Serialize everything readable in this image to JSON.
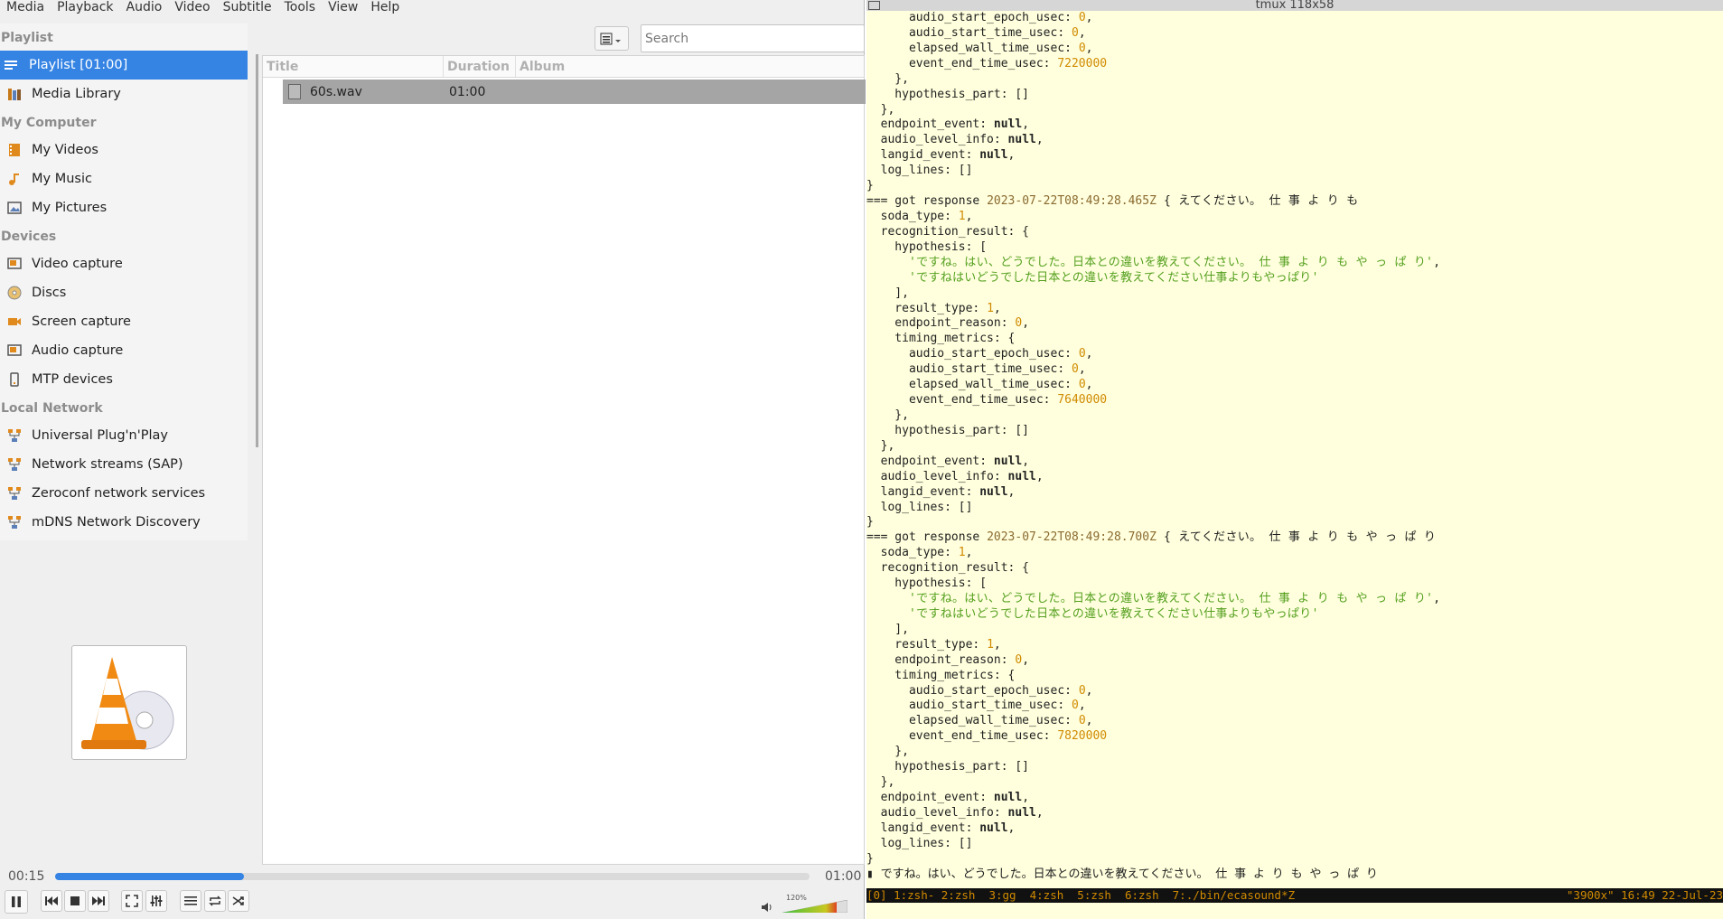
{
  "menubar": [
    "Media",
    "Playback",
    "Audio",
    "Video",
    "Subtitle",
    "Tools",
    "View",
    "Help"
  ],
  "sidebar": {
    "heading_playlist": "Playlist",
    "playlist_item": "Playlist [01:00]",
    "media_library": "Media Library",
    "heading_my_computer": "My Computer",
    "my_computer": [
      "My Videos",
      "My Music",
      "My Pictures"
    ],
    "heading_devices": "Devices",
    "devices": [
      "Video capture",
      "Discs",
      "Screen capture",
      "Audio capture",
      "MTP devices"
    ],
    "heading_local_network": "Local Network",
    "local_network": [
      "Universal Plug'n'Play",
      "Network streams (SAP)",
      "Zeroconf network services",
      "mDNS Network Discovery"
    ]
  },
  "search": {
    "placeholder": "Search"
  },
  "playlist": {
    "columns": [
      "Title",
      "Duration",
      "Album"
    ],
    "rows": [
      {
        "title": "60s.wav",
        "duration": "01:00",
        "album": ""
      }
    ]
  },
  "player": {
    "time_current": "00:15",
    "time_total": "01:00",
    "progress": 0.25,
    "volume_label": "120%"
  },
  "colors": {
    "accent": "#3584e4",
    "terminal_bg": "#ffffdd",
    "number": "#d08a00",
    "string": "#55a020"
  },
  "terminal": {
    "title": "tmux 118x58",
    "lines": [
      "      audio_start_epoch_usec: 0,",
      "      audio_start_time_usec: 0,",
      "      elapsed_wall_time_usec: 0,",
      "      event_end_time_usec: 7220000",
      "    },",
      "    hypothesis_part: []",
      "  },",
      "  endpoint_event: null,",
      "  audio_level_info: null,",
      "  langid_event: null,",
      "  log_lines: []",
      "}",
      "=== got response 2023-07-22T08:49:28.465Z { えてください。 仕 事 よ り も",
      "  soda_type: 1,",
      "  recognition_result: {",
      "    hypothesis: [",
      "      'ですね。はい、どうでした。日本との違いを教えてください。 仕 事 よ り も や っ ぱ り',",
      "      'ですねはいどうでした日本との違いを教えてください仕事よりもやっぱり'",
      "    ],",
      "    result_type: 1,",
      "    endpoint_reason: 0,",
      "    timing_metrics: {",
      "      audio_start_epoch_usec: 0,",
      "      audio_start_time_usec: 0,",
      "      elapsed_wall_time_usec: 0,",
      "      event_end_time_usec: 7640000",
      "    },",
      "    hypothesis_part: []",
      "  },",
      "  endpoint_event: null,",
      "  audio_level_info: null,",
      "  langid_event: null,",
      "  log_lines: []",
      "}",
      "=== got response 2023-07-22T08:49:28.700Z { えてください。 仕 事 よ り も や っ ぱ り",
      "  soda_type: 1,",
      "  recognition_result: {",
      "    hypothesis: [",
      "      'ですね。はい、どうでした。日本との違いを教えてください。 仕 事 よ り も や っ ぱ り',",
      "      'ですねはいどうでした日本との違いを教えてください仕事よりもやっぱり'",
      "    ],",
      "    result_type: 1,",
      "    endpoint_reason: 0,",
      "    timing_metrics: {",
      "      audio_start_epoch_usec: 0,",
      "      audio_start_time_usec: 0,",
      "      elapsed_wall_time_usec: 0,",
      "      event_end_time_usec: 7820000",
      "    },",
      "    hypothesis_part: []",
      "  },",
      "  endpoint_event: null,",
      "  audio_level_info: null,",
      "  langid_event: null,",
      "  log_lines: []",
      "}",
      "▮ ですね。はい、どうでした。日本との違いを教えてください。 仕 事 よ り も や っ ぱ り"
    ],
    "status_left": "[0] 1:zsh- 2:zsh  3:gg  4:zsh  5:zsh  6:zsh  7:./bin/ecasound*Z",
    "status_right": "\"3900x\" 16:49 22-Jul-23"
  }
}
